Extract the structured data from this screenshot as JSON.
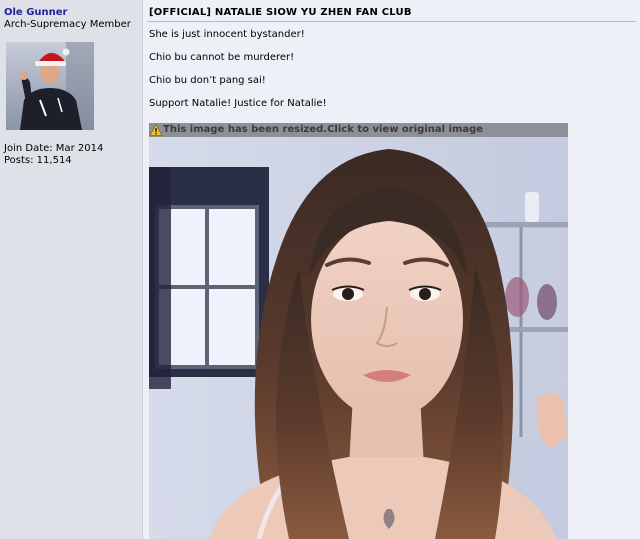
{
  "user": {
    "name": "Ole Gunner",
    "title": "Arch-Supremacy Member",
    "join_date": "Join Date: Mar 2014",
    "posts": "Posts: 11,514"
  },
  "post": {
    "thread_title": "[OFFICIAL] NATALIE SIOW YU ZHEN FAN CLUB",
    "lines": [
      "She is just innocent bystander!",
      "Chio bu cannot be murderer!",
      "Chio bu don’t pang sai!",
      "Support Natalie! Justice for Natalie!"
    ],
    "resize_notice": "This image has been resized.Click to view original image"
  },
  "icons": {
    "warning": "warning-icon"
  },
  "colors": {
    "username": "#22229c",
    "sidebar_bg": "#dfe1e9",
    "content_bg": "#eef0f8",
    "resize_bar": "#8d9096"
  }
}
